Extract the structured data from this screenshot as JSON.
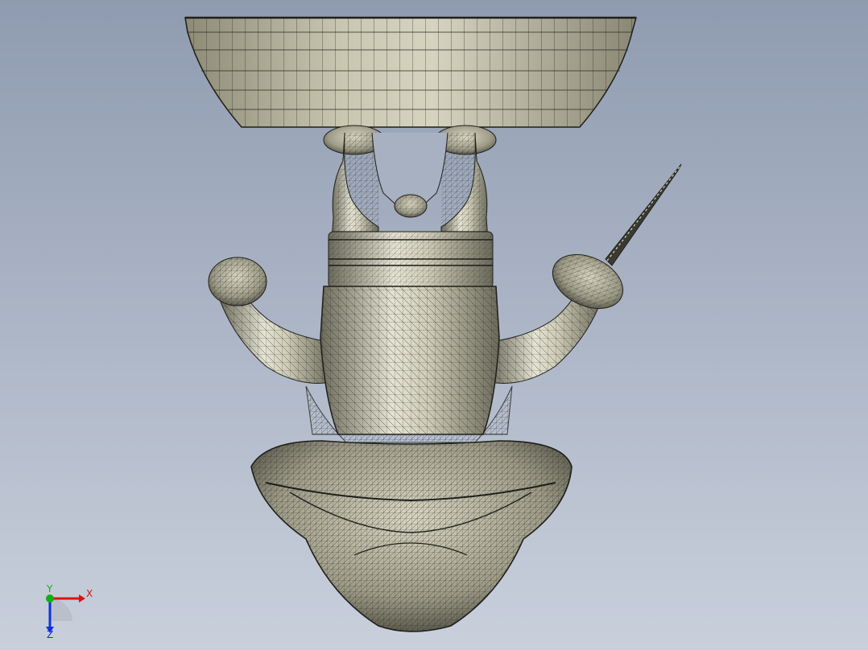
{
  "viewport": {
    "background_top": "#8f9bb0",
    "background_bottom": "#c9d0dc",
    "mesh_fill": "#c8c6b0",
    "mesh_shadow": "#6f6d5e",
    "mesh_line": "#2a2a24"
  },
  "triad": {
    "x_label": "X",
    "y_label": "Y",
    "z_label": "Z",
    "x_color": "#e01010",
    "y_color": "#10b010",
    "z_color": "#1030e0"
  }
}
